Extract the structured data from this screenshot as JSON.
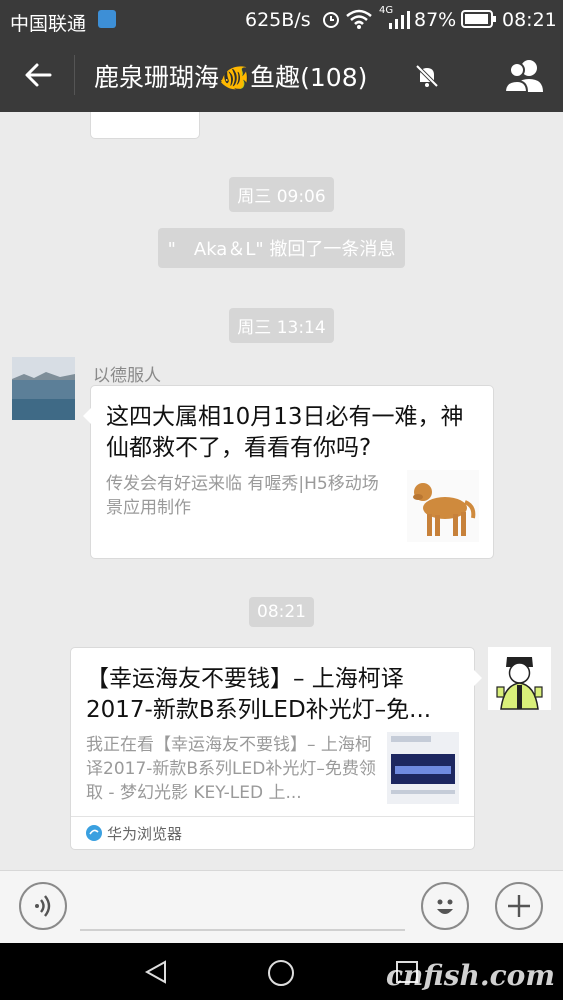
{
  "status_bar": {
    "carrier": "中国联通",
    "speed": "625B/s",
    "network": "4G",
    "battery": "87%",
    "time": "08:21"
  },
  "header": {
    "title": "鹿泉珊瑚海🐠鱼趣(108)"
  },
  "messages": {
    "time1": "周三 09:06",
    "recall": "\"　Aka＆L\" 撤回了一条消息",
    "time2": "周三 13:14",
    "sender_name": "以德服人",
    "card1_title": "这四大属相10月13日必有一难，神仙都救不了，看看有你吗?",
    "card1_desc": "传发会有好运来临 有喔秀|H5移动场景应用制作",
    "time3": "08:21",
    "card2_title": "【幸运海友不要钱】– 上海柯译2017-新款B系列LED补光灯–免...",
    "card2_desc": "我正在看【幸运海友不要钱】– 上海柯译2017-新款B系列LED补光灯–免费领取 - 梦幻光影 KEY-LED 上...",
    "card2_source": "华为浏览器"
  },
  "watermark": "cnfish.com",
  "colors": {
    "header_bg": "#3a3a3a",
    "chat_bg": "#ebebeb",
    "pill_bg": "#d6d6d6"
  }
}
